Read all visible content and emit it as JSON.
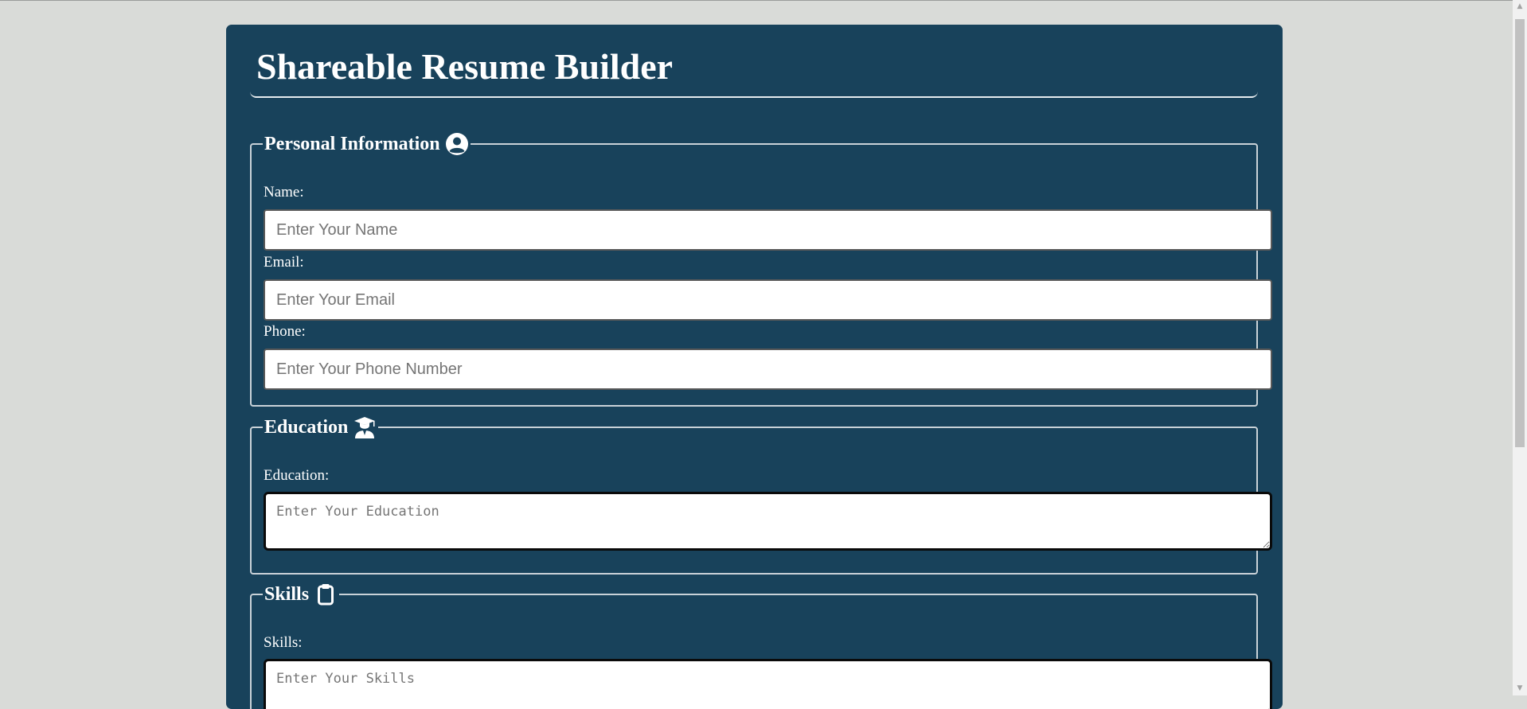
{
  "page": {
    "title": "Shareable Resume Builder"
  },
  "personal": {
    "legend": "Personal Information",
    "icon": "user-circle-icon",
    "name_label": "Name:",
    "name_placeholder": "Enter Your Name",
    "name_value": "",
    "email_label": "Email:",
    "email_placeholder": "Enter Your Email",
    "email_value": "",
    "phone_label": "Phone:",
    "phone_placeholder": "Enter Your Phone Number",
    "phone_value": ""
  },
  "education": {
    "legend": "Education",
    "icon": "graduate-icon",
    "label": "Education:",
    "placeholder": "Enter Your Education",
    "value": ""
  },
  "skills": {
    "legend": "Skills",
    "icon": "clipboard-icon",
    "label": "Skills:",
    "placeholder": "Enter Your Skills",
    "value": ""
  },
  "colors": {
    "background": "#d9dbd8",
    "card": "#18425b",
    "text": "#ffffff"
  }
}
